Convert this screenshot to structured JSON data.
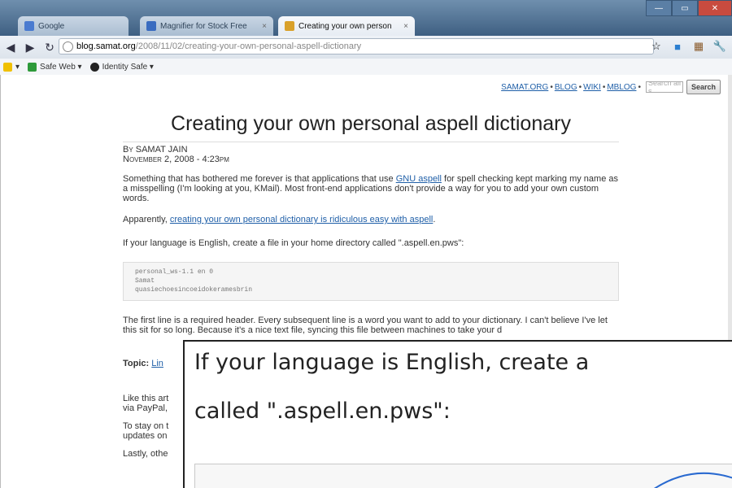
{
  "browser": {
    "tabs": [
      {
        "label": "Google",
        "icon_color": "#4a7bd0"
      },
      {
        "label": "Magnifier for Stock Free",
        "icon_color": "#3a6cc0"
      },
      {
        "label": "Creating your own person",
        "icon_color": "#d9a12a"
      }
    ],
    "url_host": "blog.samat.org",
    "url_path": "/2008/11/02/creating-your-own-personal-aspell-dictionary",
    "bookmarks": [
      {
        "label": "Safe Web ▾",
        "icon_color": "#2e9a3a"
      },
      {
        "label": "Identity Safe ▾",
        "icon_color": "#222222"
      }
    ]
  },
  "site_nav": {
    "links": [
      "SAMAT.ORG",
      "BLOG",
      "WIKI",
      "MBLOG"
    ],
    "search_placeholder": "Search all s",
    "search_button": "Search"
  },
  "post": {
    "title": "Creating your own personal aspell dictionary",
    "by_prefix": "By",
    "author": "SAMAT JAIN",
    "date": "November 2, 2008 - 4:23pm",
    "p1_a": "Something that has bothered me forever is that applications that use ",
    "p1_link": "GNU aspell",
    "p1_b": " for spell checking kept marking my name as a misspelling (I'm looking at you, KMail). Most front-end applications don't provide a way for you to add your own custom words.",
    "p2_a": "Apparently, ",
    "p2_link": "creating your own personal dictionary is ridiculous easy with aspell",
    "p2_b": ".",
    "p3": "If your language is English, create a file in your home directory called \".aspell.en.pws\":",
    "code": [
      "personal_ws-1.1 en 0",
      "Samat",
      "quasiechoesincoeidokeramesbrin"
    ],
    "p4": "The first line is a required header. Every subsequent line is a word you want to add to your dictionary. I can't believe I've let this sit for so long. Because it's a nice text file, syncing this file between machines to take your d",
    "topic_label": "Topic:",
    "topic_link": "Lin",
    "p5": "Like this art",
    "p5b": "via PayPal,",
    "p6": "To stay on t",
    "p6b": "updates on",
    "p7": "Lastly, othe"
  },
  "magnifier": {
    "line1": "If your language is English, create a",
    "line2": "called \".aspell.en.pws\":",
    "lens_color": "#2a6ad0"
  }
}
